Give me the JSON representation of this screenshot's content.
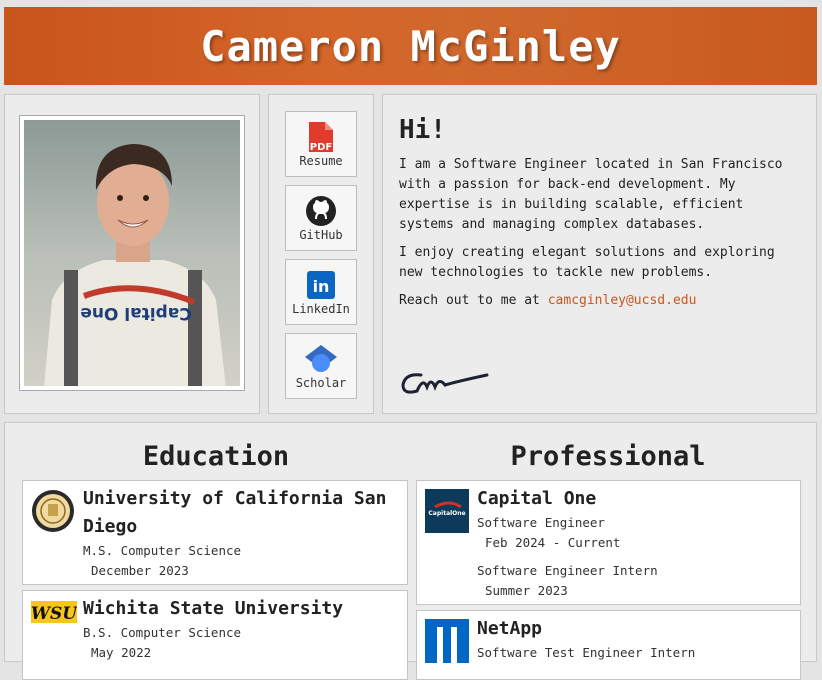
{
  "header": {
    "name": "Cameron McGinley"
  },
  "photo": {
    "shirt_text": "Capital One"
  },
  "links": [
    {
      "label": "Resume",
      "icon": "pdf-icon",
      "badge": "PDF"
    },
    {
      "label": "GitHub",
      "icon": "github-icon"
    },
    {
      "label": "LinkedIn",
      "icon": "linkedin-icon",
      "badge": "in"
    },
    {
      "label": "Scholar",
      "icon": "scholar-icon"
    }
  ],
  "intro": {
    "greeting": "Hi!",
    "p1": "I am a Software Engineer located in San Francisco with a passion for back-end development. My expertise is in building scalable, efficient systems and managing complex databases.",
    "p2": "I enjoy creating elegant solutions and exploring new technologies to tackle new problems.",
    "contact_prefix": "Reach out to me at ",
    "email": "camcginley@ucsd.edu"
  },
  "education": {
    "title": "Education",
    "items": [
      {
        "school": "University of California San Diego",
        "degree": "M.S. Computer Science",
        "date": "December 2023"
      },
      {
        "school": "Wichita State University",
        "degree": "B.S. Computer Science",
        "date": "May 2022",
        "logo_text": "WSU"
      }
    ]
  },
  "professional": {
    "title": "Professional",
    "items": [
      {
        "company": "Capital One",
        "logo_text": "CapitalOne",
        "roles": [
          {
            "title": "Software Engineer",
            "date": "Feb 2024 - Current"
          },
          {
            "title": "Software Engineer Intern",
            "date": "Summer 2023"
          }
        ]
      },
      {
        "company": "NetApp",
        "roles": [
          {
            "title": "Software Test Engineer Intern"
          }
        ]
      }
    ]
  },
  "colors": {
    "accent": "#c9541c",
    "linkedin": "#0a66c2",
    "pdf": "#e23a2b",
    "capitalone_bg": "#0b3a5b",
    "netapp": "#0067c5"
  }
}
